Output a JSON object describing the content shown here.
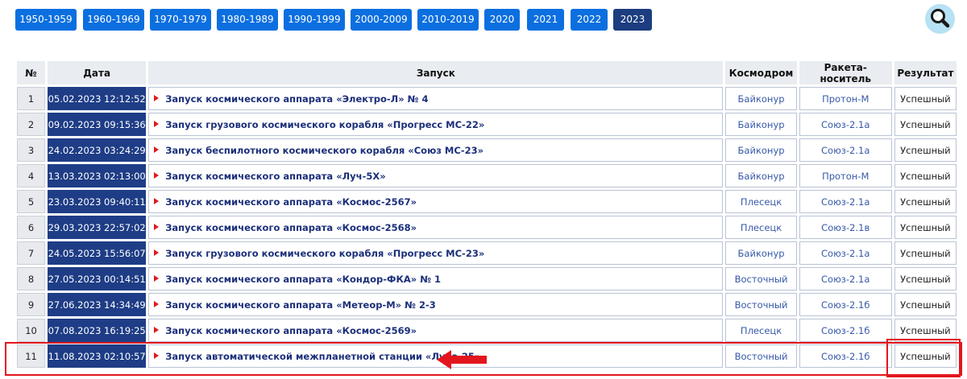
{
  "decades": [
    {
      "label": "1950-1959",
      "active": false
    },
    {
      "label": "1960-1969",
      "active": false
    },
    {
      "label": "1970-1979",
      "active": false
    },
    {
      "label": "1980-1989",
      "active": false
    },
    {
      "label": "1990-1999",
      "active": false
    },
    {
      "label": "2000-2009",
      "active": false
    },
    {
      "label": "2010-2019",
      "active": false
    },
    {
      "label": "2020",
      "active": false
    },
    {
      "label": "2021",
      "active": false
    },
    {
      "label": "2022",
      "active": false
    },
    {
      "label": "2023",
      "active": true
    }
  ],
  "search": {
    "icon": "magnifier-icon"
  },
  "table": {
    "headers": {
      "num": "№",
      "date": "Дата",
      "launch": "Запуск",
      "cosmodrome": "Космодром",
      "rocket": "Ракета-носитель",
      "result": "Результат"
    },
    "rows": [
      {
        "num": "1",
        "date": "05.02.2023 12:12:52",
        "launch": "Запуск космического аппарата «Электро-Л» № 4",
        "cosmodrome": "Байконур",
        "rocket": "Протон-М",
        "result": "Успешный"
      },
      {
        "num": "2",
        "date": "09.02.2023 09:15:36",
        "launch": "Запуск грузового космического корабля «Прогресс МС-22»",
        "cosmodrome": "Байконур",
        "rocket": "Союз-2.1а",
        "result": "Успешный"
      },
      {
        "num": "3",
        "date": "24.02.2023 03:24:29",
        "launch": "Запуск беспилотного космического корабля «Союз МС-23»",
        "cosmodrome": "Байконур",
        "rocket": "Союз-2.1а",
        "result": "Успешный"
      },
      {
        "num": "4",
        "date": "13.03.2023 02:13:00",
        "launch": "Запуск космического аппарата «Луч-5Х»",
        "cosmodrome": "Байконур",
        "rocket": "Протон-М",
        "result": "Успешный"
      },
      {
        "num": "5",
        "date": "23.03.2023 09:40:11",
        "launch": "Запуск космического аппарата «Космос-2567»",
        "cosmodrome": "Плесецк",
        "rocket": "Союз-2.1а",
        "result": "Успешный"
      },
      {
        "num": "6",
        "date": "29.03.2023 22:57:02",
        "launch": "Запуск космического аппарата «Космос-2568»",
        "cosmodrome": "Плесецк",
        "rocket": "Союз-2.1в",
        "result": "Успешный"
      },
      {
        "num": "7",
        "date": "24.05.2023 15:56:07",
        "launch": "Запуск грузового космического корабля «Прогресс МС-23»",
        "cosmodrome": "Байконур",
        "rocket": "Союз-2.1а",
        "result": "Успешный"
      },
      {
        "num": "8",
        "date": "27.05.2023 00:14:51",
        "launch": "Запуск космического аппарата «Кондор-ФКА» № 1",
        "cosmodrome": "Восточный",
        "rocket": "Союз-2.1а",
        "result": "Успешный"
      },
      {
        "num": "9",
        "date": "27.06.2023 14:34:49",
        "launch": "Запуск космического аппарата «Метеор-М» № 2-3",
        "cosmodrome": "Восточный",
        "rocket": "Союз-2.1б",
        "result": "Успешный"
      },
      {
        "num": "10",
        "date": "07.08.2023 16:19:25",
        "launch": "Запуск космического аппарата «Космос-2569»",
        "cosmodrome": "Плесецк",
        "rocket": "Союз-2.1б",
        "result": "Успешный"
      },
      {
        "num": "11",
        "date": "11.08.2023 02:10:57",
        "launch": "Запуск автоматической межпланетной станции «Луна-25»",
        "cosmodrome": "Восточный",
        "rocket": "Союз-2.1б",
        "result": "Успешный"
      }
    ]
  },
  "colors": {
    "decade_button": "#0b6fe0",
    "decade_active": "#1c3d7f",
    "date_cell": "#1e3d86",
    "launch_text": "#1b2f7a",
    "link_text": "#3759a8",
    "highlight": "#e3161d"
  }
}
